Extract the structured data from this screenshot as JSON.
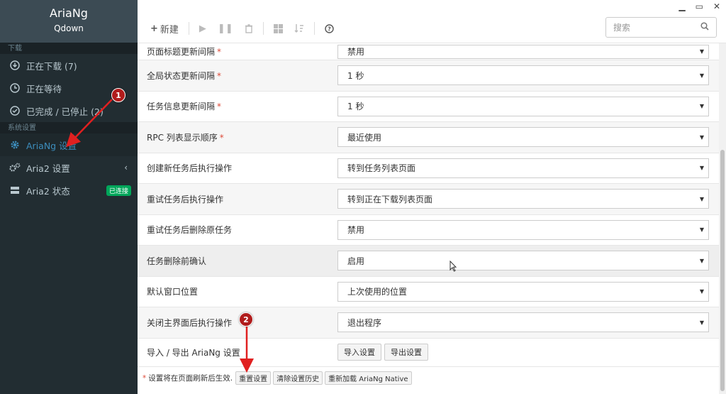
{
  "sidebar": {
    "app_name": "AriaNg",
    "app_sub": "Qdown",
    "section_download": "下载",
    "items_download": [
      {
        "label": "正在下载 (7)",
        "icon": "download-circle-icon"
      },
      {
        "label": "正在等待",
        "icon": "clock-icon"
      },
      {
        "label": "已完成 / 已停止 (2)",
        "icon": "check-circle-icon"
      }
    ],
    "section_settings": "系统设置",
    "items_settings": [
      {
        "label": "AriaNg 设置",
        "icon": "gear-icon",
        "active": true
      },
      {
        "label": "Aria2 设置",
        "icon": "gears-icon"
      },
      {
        "label": "Aria2 状态",
        "icon": "server-icon",
        "badge": "已连接"
      }
    ]
  },
  "toolbar": {
    "new_label": "新建",
    "search_placeholder": "搜索"
  },
  "settings_rows": [
    {
      "label": "页面标题更新间隔",
      "required": "*",
      "value": "禁用"
    },
    {
      "label": "全局状态更新间隔",
      "required": "*",
      "value": "1 秒"
    },
    {
      "label": "任务信息更新间隔",
      "required": "*",
      "value": "1 秒"
    },
    {
      "label": "RPC 列表显示顺序",
      "required": "*",
      "value": "最近使用"
    },
    {
      "label": "创建新任务后执行操作",
      "value": "转到任务列表页面"
    },
    {
      "label": "重试任务后执行操作",
      "value": "转到正在下载列表页面"
    },
    {
      "label": "重试任务后删除原任务",
      "value": "禁用"
    },
    {
      "label": "任务删除前确认",
      "value": "启用"
    },
    {
      "label": "默认窗口位置",
      "value": "上次使用的位置"
    },
    {
      "label": "关闭主界面后执行操作",
      "value": "退出程序"
    }
  ],
  "import_export": {
    "label": "导入 / 导出 AriaNg 设置",
    "import_btn": "导入设置",
    "export_btn": "导出设置"
  },
  "footer": {
    "required_mark": "*",
    "note": "设置将在页面刷新后生效.",
    "reset_btn": "重置设置",
    "clear_history_btn": "清除设置历史",
    "reload_btn": "重新加载 AriaNg Native"
  },
  "annotations": [
    "1",
    "2"
  ],
  "colors": {
    "sidebar_bg": "#222d32",
    "accent": "#3c8dbc",
    "marker": "#b01c1c",
    "badge": "#00a65a"
  }
}
